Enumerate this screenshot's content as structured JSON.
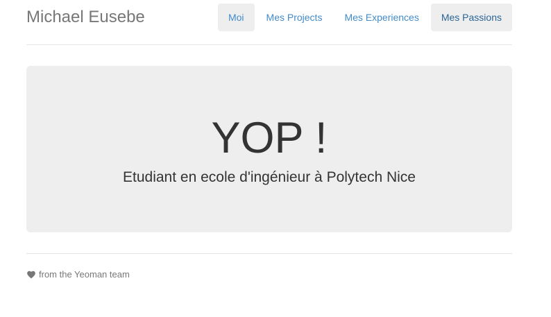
{
  "header": {
    "brand": "Michael Eusebe",
    "nav": [
      {
        "label": "Moi",
        "state": "active"
      },
      {
        "label": "Mes Projects",
        "state": "normal"
      },
      {
        "label": "Mes Experiences",
        "state": "normal"
      },
      {
        "label": "Mes Passions",
        "state": "hovered"
      }
    ]
  },
  "jumbotron": {
    "title": "YOP !",
    "subtitle": "Etudiant en ecole d'ingénieur à Polytech Nice"
  },
  "footer": {
    "icon": "heart-icon",
    "text": "from the Yeoman team"
  },
  "colors": {
    "link": "#428bca",
    "link_hover": "#2a6496",
    "panel_bg": "#eeeeee",
    "muted_text": "#777777",
    "body_text": "#333333"
  }
}
